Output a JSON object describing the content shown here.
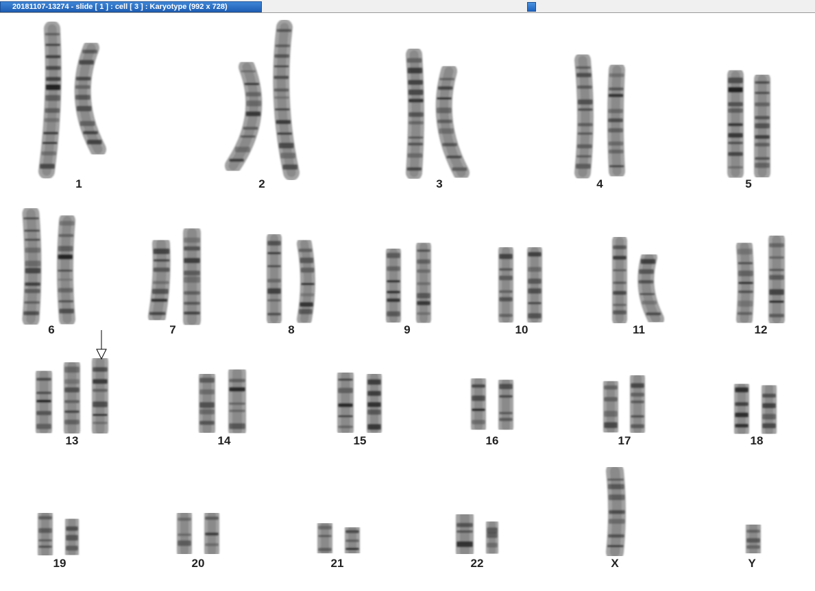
{
  "window": {
    "title": "20181107-13274 - slide [ 1 ] : cell [ 3 ] : Karyotype  (992 x 728)",
    "accent_color": "#1f5fb4"
  },
  "karyotype": {
    "labels": {
      "c1": "1",
      "c2": "2",
      "c3": "3",
      "c4": "4",
      "c5": "5",
      "c6": "6",
      "c7": "7",
      "c8": "8",
      "c9": "9",
      "c10": "10",
      "c11": "11",
      "c12": "12",
      "c13": "13",
      "c14": "14",
      "c15": "15",
      "c16": "16",
      "c17": "17",
      "c18": "18",
      "c19": "19",
      "c20": "20",
      "c21": "21",
      "c22": "22",
      "cX": "X",
      "cY": "Y"
    },
    "arrow_marker": "arrow-down-icon"
  }
}
